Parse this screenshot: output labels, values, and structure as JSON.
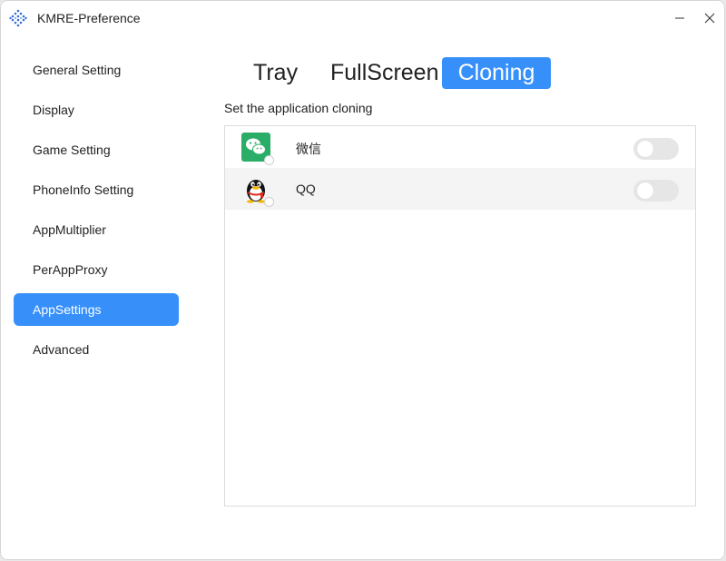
{
  "window": {
    "title": "KMRE-Preference",
    "icon": "grid-diamond-icon"
  },
  "sidebar": {
    "items": [
      {
        "label": "General Setting",
        "active": false
      },
      {
        "label": "Display",
        "active": false
      },
      {
        "label": "Game Setting",
        "active": false
      },
      {
        "label": "PhoneInfo Setting",
        "active": false
      },
      {
        "label": "AppMultiplier",
        "active": false
      },
      {
        "label": "PerAppProxy",
        "active": false
      },
      {
        "label": "AppSettings",
        "active": true
      },
      {
        "label": "Advanced",
        "active": false
      }
    ]
  },
  "tabs": [
    {
      "label": "Tray",
      "active": false
    },
    {
      "label": "FullScreen",
      "active": false
    },
    {
      "label": "Cloning",
      "active": true
    }
  ],
  "cloning": {
    "section_label": "Set the application cloning",
    "apps": [
      {
        "name": "微信",
        "icon": "wechat-icon",
        "enabled": false
      },
      {
        "name": "QQ",
        "icon": "qq-penguin-icon",
        "enabled": false
      }
    ]
  },
  "colors": {
    "accent": "#3790fa",
    "toggle_off": "#e6e6e6",
    "wechat": "#2aae67"
  }
}
